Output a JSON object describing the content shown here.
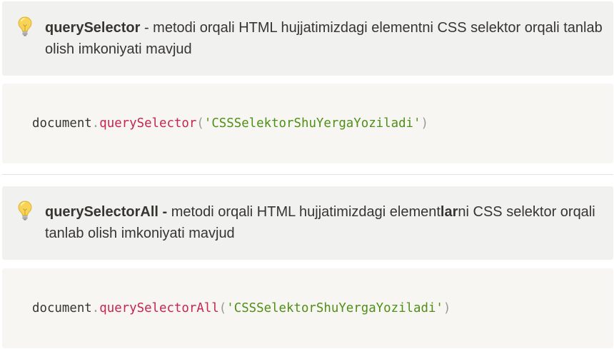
{
  "callouts": [
    {
      "icon": "light-bulb-icon",
      "bold": "querySelector",
      "text1": " - metodi orqali HTML hujjatimizdagi elementni CSS selektor orqali tanlab olish imkoniyati mavjud"
    },
    {
      "icon": "light-bulb-icon",
      "bold": "querySelectorAll - ",
      "text1": " metodi orqali HTML hujjatimizdagi element",
      "bold2": "lar",
      "text2": "ni CSS selektor orqali tanlab olish imkoniyati mavjud"
    }
  ],
  "code_blocks": [
    {
      "object": "document",
      "dot": ".",
      "method": "querySelector",
      "open": "(",
      "arg": "'CSSSelektorShuYergaYoziladi'",
      "close": ")"
    },
    {
      "object": "document",
      "dot": ".",
      "method": "querySelectorAll",
      "open": "(",
      "arg": "'CSSSelektorShuYergaYoziladi'",
      "close": ")"
    }
  ],
  "colors": {
    "callout_bg": "#f1f1ef",
    "code_bg": "#f7f6f3",
    "code_method": "#c7254e",
    "code_string": "#4f8f15",
    "bulb": "#f5cf4a"
  }
}
